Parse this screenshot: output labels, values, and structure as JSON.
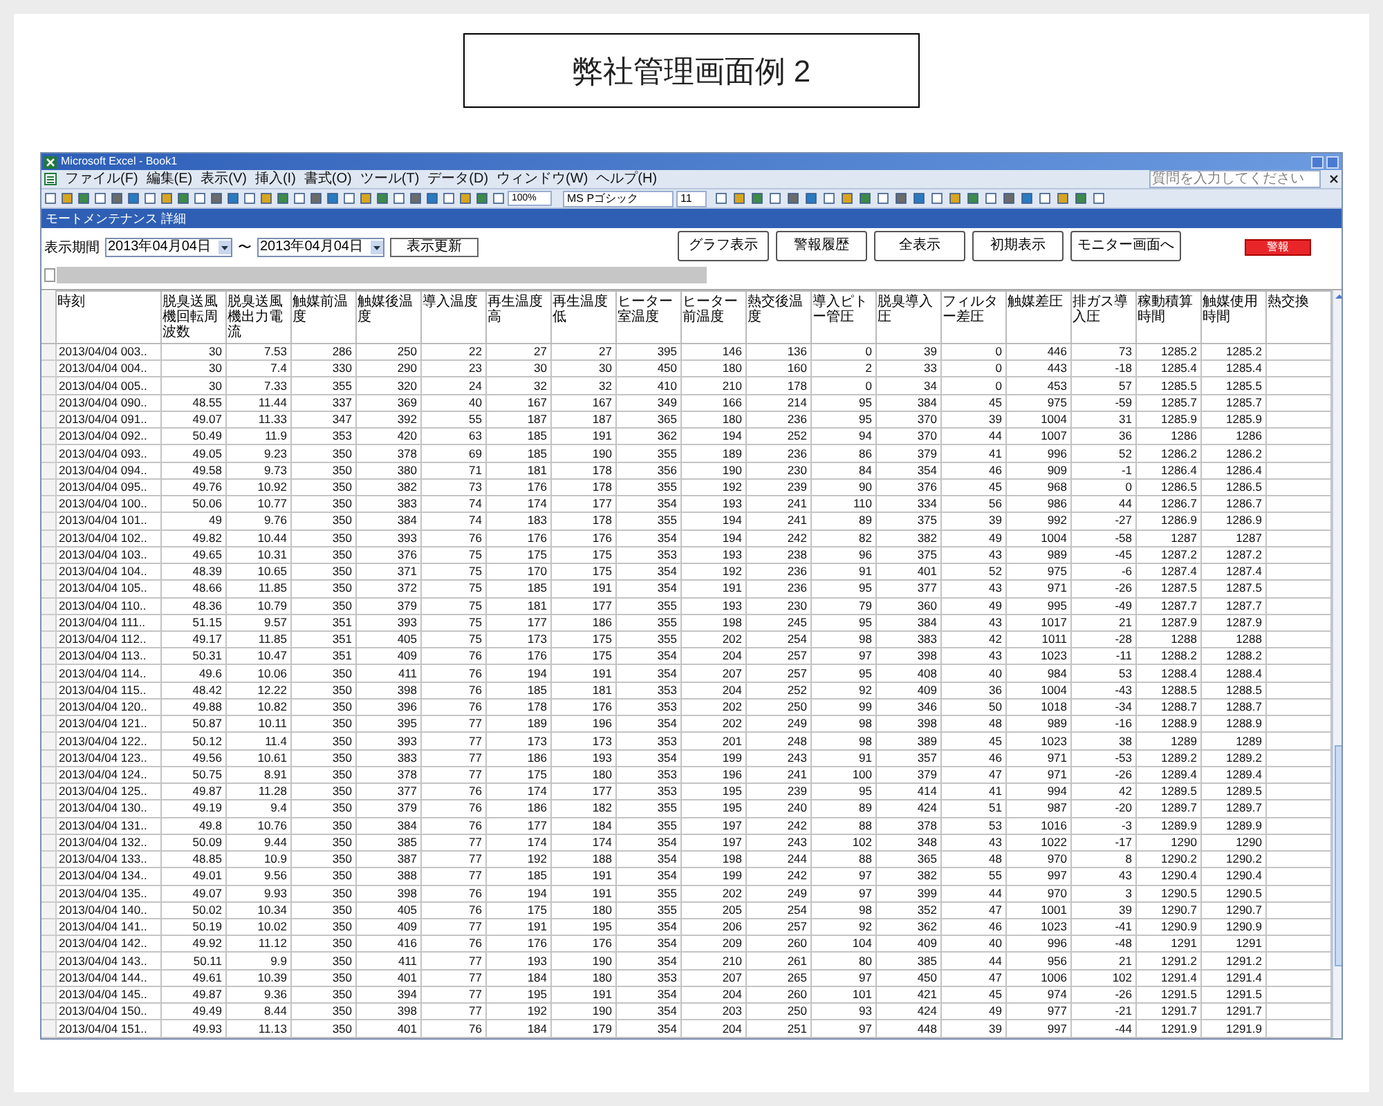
{
  "page_title": "弊社管理画面例 2",
  "window": {
    "title": "Microsoft Excel - Book1"
  },
  "menu": [
    "ファイル(F)",
    "編集(E)",
    "表示(V)",
    "挿入(I)",
    "書式(O)",
    "ツール(T)",
    "データ(D)",
    "ウィンドウ(W)",
    "ヘルプ(H)"
  ],
  "help_search": {
    "placeholder": "質問を入力してください"
  },
  "toolbar": {
    "zoom": "100%",
    "font": "MS Pゴシック",
    "font_size": "11"
  },
  "form": {
    "title": "モートメンテナンス 詳細",
    "period_label": "表示期間",
    "date_from": "2013年04月04日",
    "separator": "〜",
    "date_to": "2013年04月04日",
    "refresh": "表示更新",
    "buttons": [
      "グラフ表示",
      "警報履歴",
      "全表示",
      "初期表示",
      "モニター画面へ"
    ],
    "alarm": "警報"
  },
  "table": {
    "columns": [
      "時刻",
      "脱臭送風機回転周波数",
      "脱臭送風機出力電流",
      "触媒前温度",
      "触媒後温度",
      "導入温度",
      "再生温度高",
      "再生温度低",
      "ヒーター室温度",
      "ヒーター前温度",
      "熱交後温度",
      "導入ピトー管圧",
      "脱臭導入圧",
      "フィルター差圧",
      "触媒差圧",
      "排ガス導入圧",
      "稼動積算時間",
      "触媒使用時間",
      "熱交換"
    ],
    "rows": [
      [
        "2013/04/04 003..",
        "30",
        "7.53",
        "286",
        "250",
        "22",
        "27",
        "27",
        "395",
        "146",
        "136",
        "0",
        "39",
        "0",
        "446",
        "73",
        "1285.2",
        "1285.2"
      ],
      [
        "2013/04/04 004..",
        "30",
        "7.4",
        "330",
        "290",
        "23",
        "30",
        "30",
        "450",
        "180",
        "160",
        "2",
        "33",
        "0",
        "443",
        "-18",
        "1285.4",
        "1285.4"
      ],
      [
        "2013/04/04 005..",
        "30",
        "7.33",
        "355",
        "320",
        "24",
        "32",
        "32",
        "410",
        "210",
        "178",
        "0",
        "34",
        "0",
        "453",
        "57",
        "1285.5",
        "1285.5"
      ],
      [
        "2013/04/04 090..",
        "48.55",
        "11.44",
        "337",
        "369",
        "40",
        "167",
        "167",
        "349",
        "166",
        "214",
        "95",
        "384",
        "45",
        "975",
        "-59",
        "1285.7",
        "1285.7"
      ],
      [
        "2013/04/04 091..",
        "49.07",
        "11.33",
        "347",
        "392",
        "55",
        "187",
        "187",
        "365",
        "180",
        "236",
        "95",
        "370",
        "39",
        "1004",
        "31",
        "1285.9",
        "1285.9"
      ],
      [
        "2013/04/04 092..",
        "50.49",
        "11.9",
        "353",
        "420",
        "63",
        "185",
        "191",
        "362",
        "194",
        "252",
        "94",
        "370",
        "44",
        "1007",
        "36",
        "1286",
        "1286"
      ],
      [
        "2013/04/04 093..",
        "49.05",
        "9.23",
        "350",
        "378",
        "69",
        "185",
        "190",
        "355",
        "189",
        "236",
        "86",
        "379",
        "41",
        "996",
        "52",
        "1286.2",
        "1286.2"
      ],
      [
        "2013/04/04 094..",
        "49.58",
        "9.73",
        "350",
        "380",
        "71",
        "181",
        "178",
        "356",
        "190",
        "230",
        "84",
        "354",
        "46",
        "909",
        "-1",
        "1286.4",
        "1286.4"
      ],
      [
        "2013/04/04 095..",
        "49.76",
        "10.92",
        "350",
        "382",
        "73",
        "176",
        "178",
        "355",
        "192",
        "239",
        "90",
        "376",
        "45",
        "968",
        "0",
        "1286.5",
        "1286.5"
      ],
      [
        "2013/04/04 100..",
        "50.06",
        "10.77",
        "350",
        "383",
        "74",
        "174",
        "177",
        "354",
        "193",
        "241",
        "110",
        "334",
        "56",
        "986",
        "44",
        "1286.7",
        "1286.7"
      ],
      [
        "2013/04/04 101..",
        "49",
        "9.76",
        "350",
        "384",
        "74",
        "183",
        "178",
        "355",
        "194",
        "241",
        "89",
        "375",
        "39",
        "992",
        "-27",
        "1286.9",
        "1286.9"
      ],
      [
        "2013/04/04 102..",
        "49.82",
        "10.44",
        "350",
        "393",
        "76",
        "176",
        "176",
        "354",
        "194",
        "242",
        "82",
        "382",
        "49",
        "1004",
        "-58",
        "1287",
        "1287"
      ],
      [
        "2013/04/04 103..",
        "49.65",
        "10.31",
        "350",
        "376",
        "75",
        "175",
        "175",
        "353",
        "193",
        "238",
        "96",
        "375",
        "43",
        "989",
        "-45",
        "1287.2",
        "1287.2"
      ],
      [
        "2013/04/04 104..",
        "48.39",
        "10.65",
        "350",
        "371",
        "75",
        "170",
        "175",
        "354",
        "192",
        "236",
        "91",
        "401",
        "52",
        "975",
        "-6",
        "1287.4",
        "1287.4"
      ],
      [
        "2013/04/04 105..",
        "48.66",
        "11.85",
        "350",
        "372",
        "75",
        "185",
        "191",
        "354",
        "191",
        "236",
        "95",
        "377",
        "43",
        "971",
        "-26",
        "1287.5",
        "1287.5"
      ],
      [
        "2013/04/04 110..",
        "48.36",
        "10.79",
        "350",
        "379",
        "75",
        "181",
        "177",
        "355",
        "193",
        "230",
        "79",
        "360",
        "49",
        "995",
        "-49",
        "1287.7",
        "1287.7"
      ],
      [
        "2013/04/04 111..",
        "51.15",
        "9.57",
        "351",
        "393",
        "75",
        "177",
        "186",
        "355",
        "198",
        "245",
        "95",
        "384",
        "43",
        "1017",
        "21",
        "1287.9",
        "1287.9"
      ],
      [
        "2013/04/04 112..",
        "49.17",
        "11.85",
        "351",
        "405",
        "75",
        "173",
        "175",
        "355",
        "202",
        "254",
        "98",
        "383",
        "42",
        "1011",
        "-28",
        "1288",
        "1288"
      ],
      [
        "2013/04/04 113..",
        "50.31",
        "10.47",
        "351",
        "409",
        "76",
        "176",
        "175",
        "354",
        "204",
        "257",
        "97",
        "398",
        "43",
        "1023",
        "-11",
        "1288.2",
        "1288.2"
      ],
      [
        "2013/04/04 114..",
        "49.6",
        "10.06",
        "350",
        "411",
        "76",
        "194",
        "191",
        "354",
        "207",
        "257",
        "95",
        "408",
        "40",
        "984",
        "53",
        "1288.4",
        "1288.4"
      ],
      [
        "2013/04/04 115..",
        "48.42",
        "12.22",
        "350",
        "398",
        "76",
        "185",
        "181",
        "353",
        "204",
        "252",
        "92",
        "409",
        "36",
        "1004",
        "-43",
        "1288.5",
        "1288.5"
      ],
      [
        "2013/04/04 120..",
        "49.88",
        "10.82",
        "350",
        "396",
        "76",
        "178",
        "176",
        "353",
        "202",
        "250",
        "99",
        "346",
        "50",
        "1018",
        "-34",
        "1288.7",
        "1288.7"
      ],
      [
        "2013/04/04 121..",
        "50.87",
        "10.11",
        "350",
        "395",
        "77",
        "189",
        "196",
        "354",
        "202",
        "249",
        "98",
        "398",
        "48",
        "989",
        "-16",
        "1288.9",
        "1288.9"
      ],
      [
        "2013/04/04 122..",
        "50.12",
        "11.4",
        "350",
        "393",
        "77",
        "173",
        "173",
        "353",
        "201",
        "248",
        "98",
        "389",
        "45",
        "1023",
        "38",
        "1289",
        "1289"
      ],
      [
        "2013/04/04 123..",
        "49.56",
        "10.61",
        "350",
        "383",
        "77",
        "186",
        "193",
        "354",
        "199",
        "243",
        "91",
        "357",
        "46",
        "971",
        "-53",
        "1289.2",
        "1289.2"
      ],
      [
        "2013/04/04 124..",
        "50.75",
        "8.91",
        "350",
        "378",
        "77",
        "175",
        "180",
        "353",
        "196",
        "241",
        "100",
        "379",
        "47",
        "971",
        "-26",
        "1289.4",
        "1289.4"
      ],
      [
        "2013/04/04 125..",
        "49.87",
        "11.28",
        "350",
        "377",
        "76",
        "174",
        "177",
        "353",
        "195",
        "239",
        "95",
        "414",
        "41",
        "994",
        "42",
        "1289.5",
        "1289.5"
      ],
      [
        "2013/04/04 130..",
        "49.19",
        "9.4",
        "350",
        "379",
        "76",
        "186",
        "182",
        "355",
        "195",
        "240",
        "89",
        "424",
        "51",
        "987",
        "-20",
        "1289.7",
        "1289.7"
      ],
      [
        "2013/04/04 131..",
        "49.8",
        "10.76",
        "350",
        "384",
        "76",
        "177",
        "184",
        "355",
        "197",
        "242",
        "88",
        "378",
        "53",
        "1016",
        "-3",
        "1289.9",
        "1289.9"
      ],
      [
        "2013/04/04 132..",
        "50.09",
        "9.44",
        "350",
        "385",
        "77",
        "174",
        "174",
        "354",
        "197",
        "243",
        "102",
        "348",
        "43",
        "1022",
        "-17",
        "1290",
        "1290"
      ],
      [
        "2013/04/04 133..",
        "48.85",
        "10.9",
        "350",
        "387",
        "77",
        "192",
        "188",
        "354",
        "198",
        "244",
        "88",
        "365",
        "48",
        "970",
        "8",
        "1290.2",
        "1290.2"
      ],
      [
        "2013/04/04 134..",
        "49.01",
        "9.56",
        "350",
        "388",
        "77",
        "185",
        "191",
        "354",
        "199",
        "242",
        "97",
        "382",
        "55",
        "997",
        "43",
        "1290.4",
        "1290.4"
      ],
      [
        "2013/04/04 135..",
        "49.07",
        "9.93",
        "350",
        "398",
        "76",
        "194",
        "191",
        "355",
        "202",
        "249",
        "97",
        "399",
        "44",
        "970",
        "3",
        "1290.5",
        "1290.5"
      ],
      [
        "2013/04/04 140..",
        "50.02",
        "10.34",
        "350",
        "405",
        "76",
        "175",
        "180",
        "355",
        "205",
        "254",
        "98",
        "352",
        "47",
        "1001",
        "39",
        "1290.7",
        "1290.7"
      ],
      [
        "2013/04/04 141..",
        "50.19",
        "10.02",
        "350",
        "409",
        "77",
        "191",
        "195",
        "354",
        "206",
        "257",
        "92",
        "362",
        "46",
        "1023",
        "-41",
        "1290.9",
        "1290.9"
      ],
      [
        "2013/04/04 142..",
        "49.92",
        "11.12",
        "350",
        "416",
        "76",
        "176",
        "176",
        "354",
        "209",
        "260",
        "104",
        "409",
        "40",
        "996",
        "-48",
        "1291",
        "1291"
      ],
      [
        "2013/04/04 143..",
        "50.11",
        "9.9",
        "350",
        "411",
        "77",
        "193",
        "190",
        "354",
        "210",
        "261",
        "80",
        "385",
        "44",
        "956",
        "21",
        "1291.2",
        "1291.2"
      ],
      [
        "2013/04/04 144..",
        "49.61",
        "10.39",
        "350",
        "401",
        "77",
        "184",
        "180",
        "353",
        "207",
        "265",
        "97",
        "450",
        "47",
        "1006",
        "102",
        "1291.4",
        "1291.4"
      ],
      [
        "2013/04/04 145..",
        "49.87",
        "9.36",
        "350",
        "394",
        "77",
        "195",
        "191",
        "354",
        "204",
        "260",
        "101",
        "421",
        "45",
        "974",
        "-26",
        "1291.5",
        "1291.5"
      ],
      [
        "2013/04/04 150..",
        "49.49",
        "8.44",
        "350",
        "398",
        "77",
        "192",
        "190",
        "354",
        "203",
        "250",
        "93",
        "424",
        "49",
        "977",
        "-21",
        "1291.7",
        "1291.7"
      ],
      [
        "2013/04/04 151..",
        "49.93",
        "11.13",
        "350",
        "401",
        "76",
        "184",
        "179",
        "354",
        "204",
        "251",
        "97",
        "448",
        "39",
        "997",
        "-44",
        "1291.9",
        "1291.9"
      ]
    ]
  }
}
